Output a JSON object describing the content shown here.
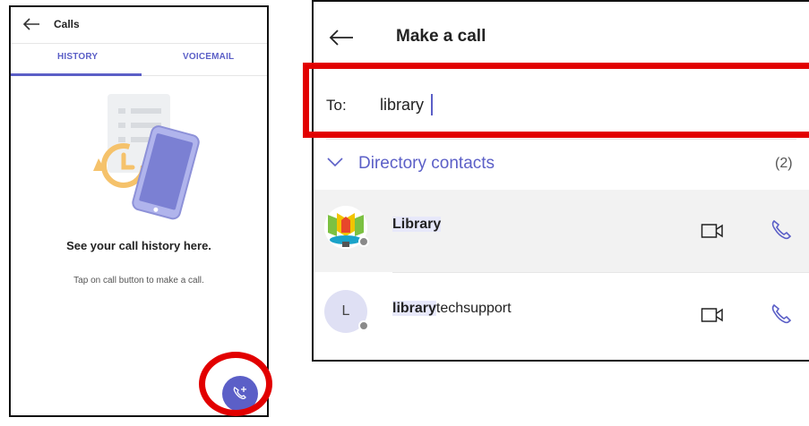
{
  "left": {
    "title": "Calls",
    "tabs": [
      {
        "label": "HISTORY",
        "active": true
      },
      {
        "label": "VOICEMAIL",
        "active": false
      }
    ],
    "empty_title": "See your call history here.",
    "empty_subtitle": "Tap on call button to make a call."
  },
  "right": {
    "title": "Make a call",
    "to_label": "To:",
    "to_value": "library",
    "directory_label": "Directory contacts",
    "directory_count": "(2)",
    "contacts": [
      {
        "highlight": "Library",
        "rest": "",
        "initial": ""
      },
      {
        "highlight": "library",
        "rest": "techsupport",
        "initial": "L"
      }
    ]
  },
  "colors": {
    "accent": "#5b5fc7",
    "highlight": "#e20000",
    "presence": "#8a8a8a"
  },
  "icons": [
    "back-arrow-icon",
    "chevron-down-icon",
    "video-call-icon",
    "phone-call-icon",
    "add-call-icon"
  ]
}
